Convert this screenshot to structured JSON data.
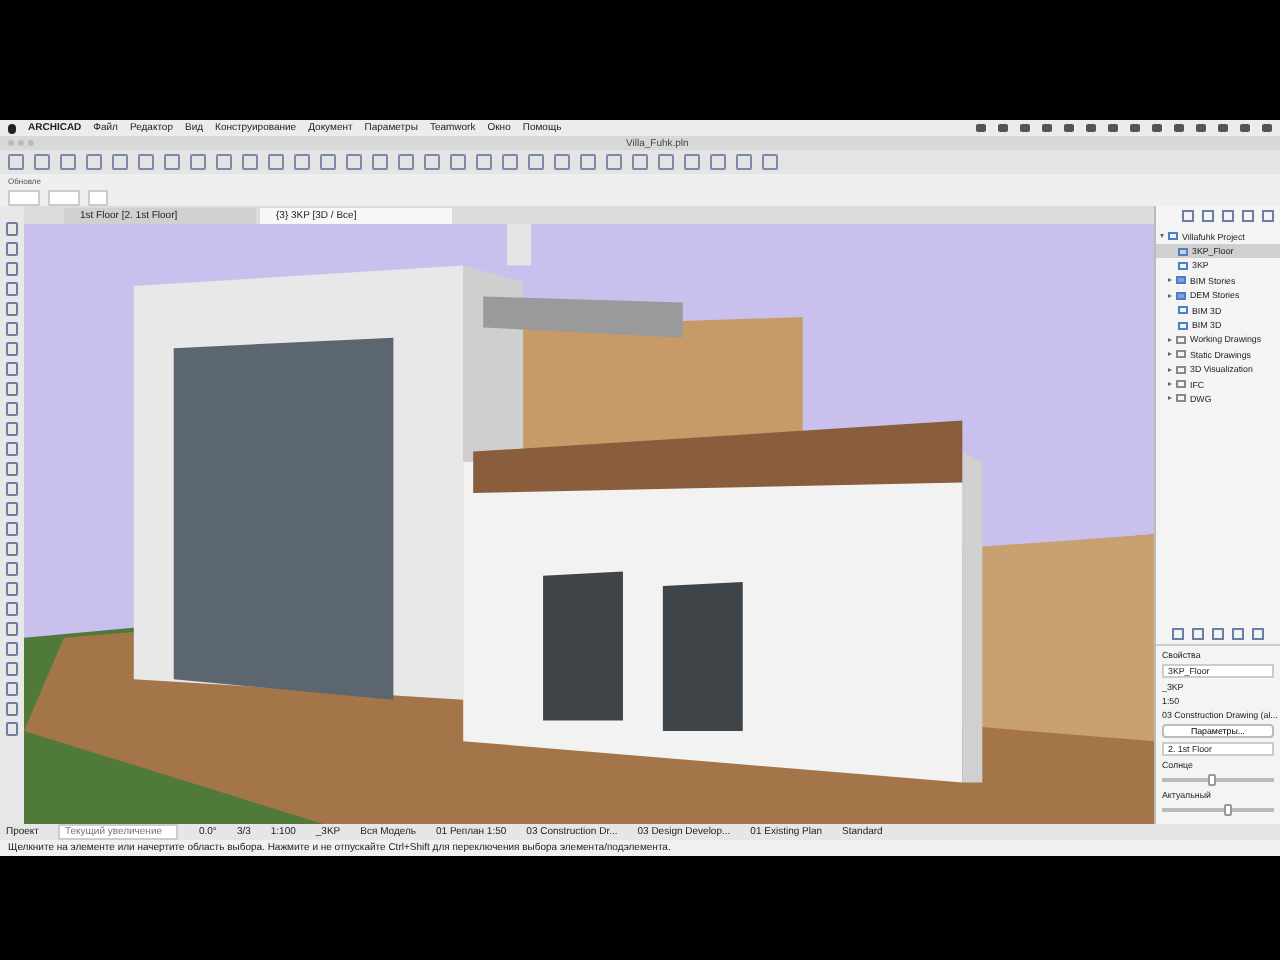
{
  "menu_bar": {
    "items": [
      "ARCHICAD",
      "Файл",
      "Редактор",
      "Вид",
      "Конструирование",
      "Документ",
      "Параметры",
      "Teamwork",
      "Окно",
      "Помощь"
    ]
  },
  "window": {
    "title": "Villa_Fuhk.pln"
  },
  "info_box": {
    "label": "Обновле"
  },
  "tabs": [
    {
      "label": "1st Floor [2. 1st Floor]",
      "selected": false
    },
    {
      "label": "{3} 3KP [3D / Все]",
      "selected": true
    }
  ],
  "navigator": {
    "project": "Villafuhk Project",
    "children": [
      {
        "label": "3KP_Floor",
        "kind": "view",
        "selected": true
      },
      {
        "label": "3KP",
        "kind": "view",
        "selected": false
      },
      {
        "label": "BIM Stories",
        "kind": "group",
        "selected": false
      },
      {
        "label": "DEM Stories",
        "kind": "group",
        "selected": false
      },
      {
        "label": "BIM 3D",
        "kind": "view",
        "selected": false
      },
      {
        "label": "BIM 3D",
        "kind": "view",
        "selected": false
      },
      {
        "label": "Working Drawings",
        "kind": "folder",
        "selected": false
      },
      {
        "label": "Static Drawings",
        "kind": "folder",
        "selected": false
      },
      {
        "label": "3D Visualization",
        "kind": "folder",
        "selected": false
      },
      {
        "label": "IFC",
        "kind": "folder",
        "selected": false
      },
      {
        "label": "DWG",
        "kind": "folder",
        "selected": false
      }
    ]
  },
  "properties": {
    "header": "Свойства",
    "name": "3KP_Floor",
    "layer": "_3KP",
    "scale": "1:50",
    "set": "03 Construction Drawing (al...",
    "button": "Параметры...",
    "story": "2. 1st Floor",
    "sliders": [
      {
        "label": "Солнце",
        "level": 0.45
      },
      {
        "label": "Актуальный",
        "level": 0.62
      }
    ]
  },
  "status_bar": {
    "mode": "Проект",
    "search_placeholder": "Текущий увеличение",
    "angle": "0.0°",
    "count": "3/3",
    "scale": "1:100",
    "layer": "_3KP",
    "model": "Вся Модель",
    "items": [
      "01 Реплан 1:50",
      "03 Construction Dr...",
      "03 Design Develop...",
      "01 Existing Plan",
      "Standard"
    ]
  },
  "message": "Щелкните на элементе или начертите область выбора. Нажмите и не отпускайте Ctrl+Shift для переключения выбора элемента/подэлемента."
}
